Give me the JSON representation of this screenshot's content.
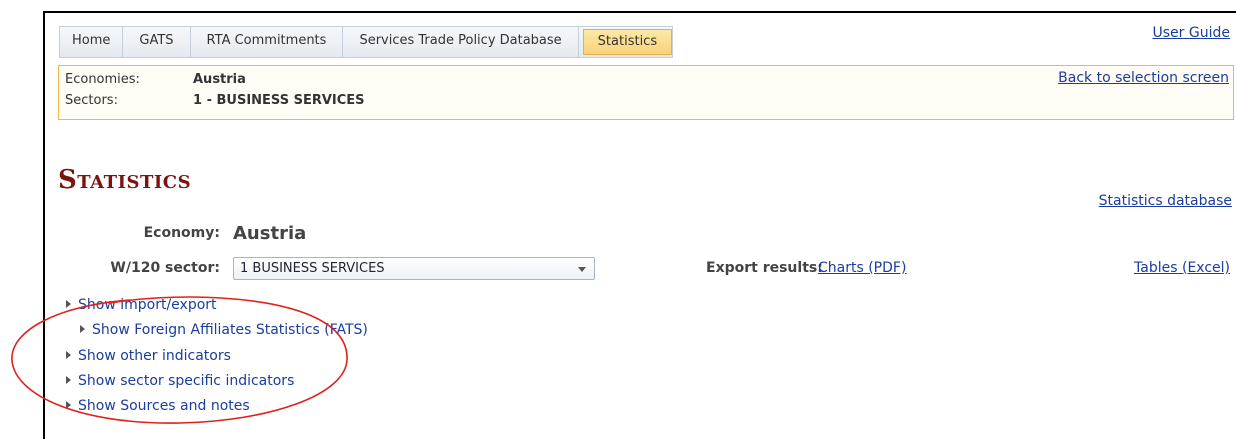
{
  "nav": {
    "tabs": [
      {
        "label": "Home"
      },
      {
        "label": "GATS"
      },
      {
        "label": "RTA Commitments"
      },
      {
        "label": "Services Trade Policy Database"
      },
      {
        "label": "Statistics",
        "active": true
      }
    ],
    "user_guide": "User Guide"
  },
  "selection": {
    "economies_label": "Economies:",
    "economies_value": "Austria",
    "sectors_label": "Sectors:",
    "sectors_value": "1 - BUSINESS SERVICES",
    "back_link": "Back to selection screen"
  },
  "main": {
    "title": "Statistics",
    "statistics_db_link": "Statistics database",
    "economy_label": "Economy:",
    "economy_value": "Austria",
    "sector_label": "W/120 sector:",
    "sector_selected": "1 BUSINESS SERVICES",
    "export_label": "Export results:",
    "charts_link": "Charts (PDF)",
    "tables_link": "Tables (Excel)"
  },
  "toggles": [
    {
      "label": "Show import/export"
    },
    {
      "label": "Show Foreign Affiliates Statistics (FATS)"
    },
    {
      "label": "Show other indicators"
    },
    {
      "label": "Show sector specific indicators"
    },
    {
      "label": "Show Sources and notes"
    }
  ],
  "colors": {
    "title": "#7b1411",
    "link": "#1a3d9e",
    "active_tab": "#f8d27a",
    "selection_border": "#f0b84a",
    "annotation": "#e0201c"
  }
}
